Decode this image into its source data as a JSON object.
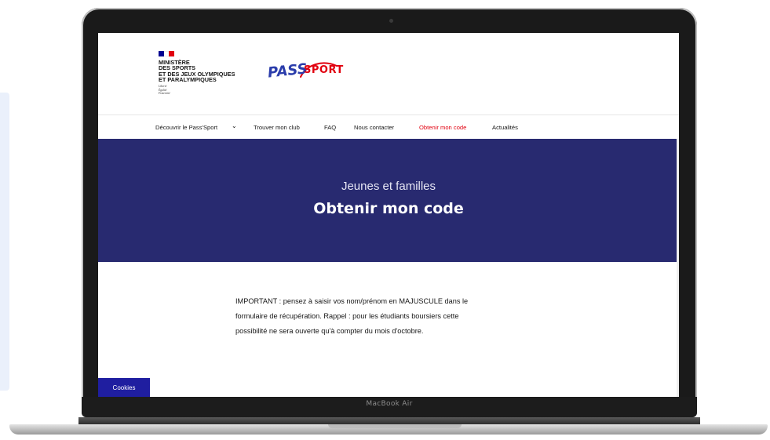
{
  "device": {
    "model_label": "MacBook Air"
  },
  "header": {
    "ministry_lines": [
      "Ministère",
      "des sports",
      "et des jeux olympiques",
      "et paralympiques"
    ],
    "motto_lines": [
      "Liberté",
      "Égalité",
      "Fraternité"
    ],
    "logo": {
      "pass": "PASS",
      "sport": "SPORT"
    }
  },
  "nav": {
    "items": [
      {
        "label": "Découvrir le Pass'Sport",
        "has_dropdown": true
      },
      {
        "label": "Trouver mon club"
      },
      {
        "label": "FAQ"
      },
      {
        "label": "Nous contacter"
      },
      {
        "label": "Obtenir mon code",
        "active": true
      },
      {
        "label": "Actualités"
      }
    ]
  },
  "hero": {
    "subtitle": "Jeunes et familles",
    "title": "Obtenir mon code"
  },
  "content": {
    "important_lines": [
      "IMPORTANT : pensez à saisir  vos nom/prénom en MAJUSCULE dans le",
      "formulaire de récupération. Rappel : pour les étudiants boursiers cette",
      "possibilité ne sera ouverte qu'à compter du mois d'octobre."
    ]
  },
  "cookies": {
    "label": "Cookies"
  },
  "colors": {
    "hero_bg": "#282a70",
    "accent_red": "#e1000f",
    "brand_blue": "#2b3dab",
    "cookies_bg": "#1f1ea0",
    "flag_blue": "#000091",
    "flag_white": "#ffffff",
    "flag_red": "#e1000f"
  },
  "icons": {
    "dropdown": "chevron-down-icon",
    "camera": "camera-icon"
  }
}
